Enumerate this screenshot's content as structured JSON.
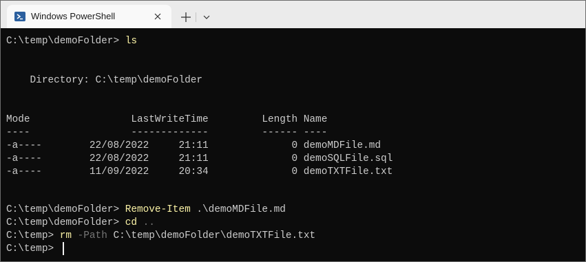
{
  "window": {
    "tab_title": "Windows PowerShell",
    "icons": {
      "tab": "powershell-icon",
      "close": "close-icon",
      "new_tab": "plus-icon",
      "dropdown": "chevron-down-icon"
    }
  },
  "terminal": {
    "prompt1": "C:\\temp\\demoFolder> ",
    "cmd1": "ls",
    "directory": "    Directory: C:\\temp\\demoFolder",
    "header": "Mode                 LastWriteTime         Length Name",
    "underline": "----                 -------------         ------ ----",
    "rows": [
      "-a----        22/08/2022     21:11              0 demoMDFile.md",
      "-a----        22/08/2022     21:11              0 demoSQLFile.sql",
      "-a----        11/09/2022     20:34              0 demoTXTFile.txt"
    ],
    "prompt2": "C:\\temp\\demoFolder> ",
    "cmd2": "Remove-Item",
    "cmd2_arg": " .\\demoMDFile.md",
    "prompt3": "C:\\temp\\demoFolder> ",
    "cmd3": "cd",
    "cmd3_arg": " ..",
    "prompt4": "C:\\temp> ",
    "cmd4": "rm",
    "cmd4_param": " -Path",
    "cmd4_arg": " C:\\temp\\demoFolder\\demoTXTFile.txt",
    "prompt5": "C:\\temp> "
  }
}
